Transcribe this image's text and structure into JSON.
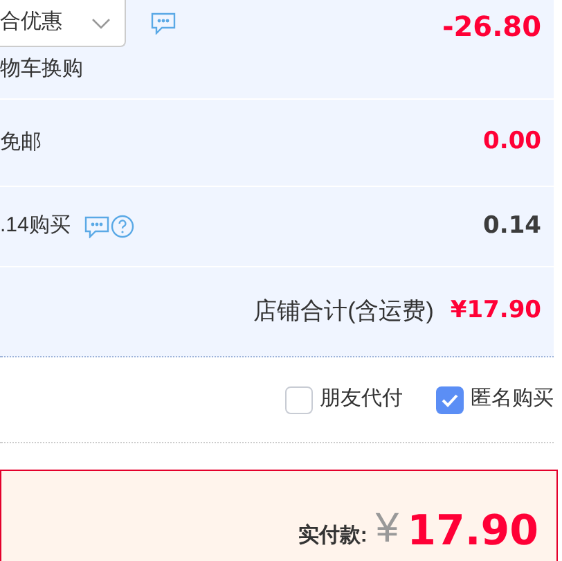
{
  "promo_row": {
    "dropdown": "合优惠",
    "note": "物车换购",
    "amount": "-26.80"
  },
  "shipping_row": {
    "label": "免邮",
    "amount": "0.00"
  },
  "insurance_row": {
    "label": ".14购买",
    "amount": "0.14"
  },
  "store_total": {
    "label": "店铺合计(含运费)",
    "amount": "¥17.90"
  },
  "options": [
    {
      "label": "朋友代付",
      "checked": false
    },
    {
      "label": "匿名购买",
      "checked": true
    }
  ],
  "payment": {
    "label": "实付款:",
    "currency": "¥",
    "amount": "17.90"
  }
}
